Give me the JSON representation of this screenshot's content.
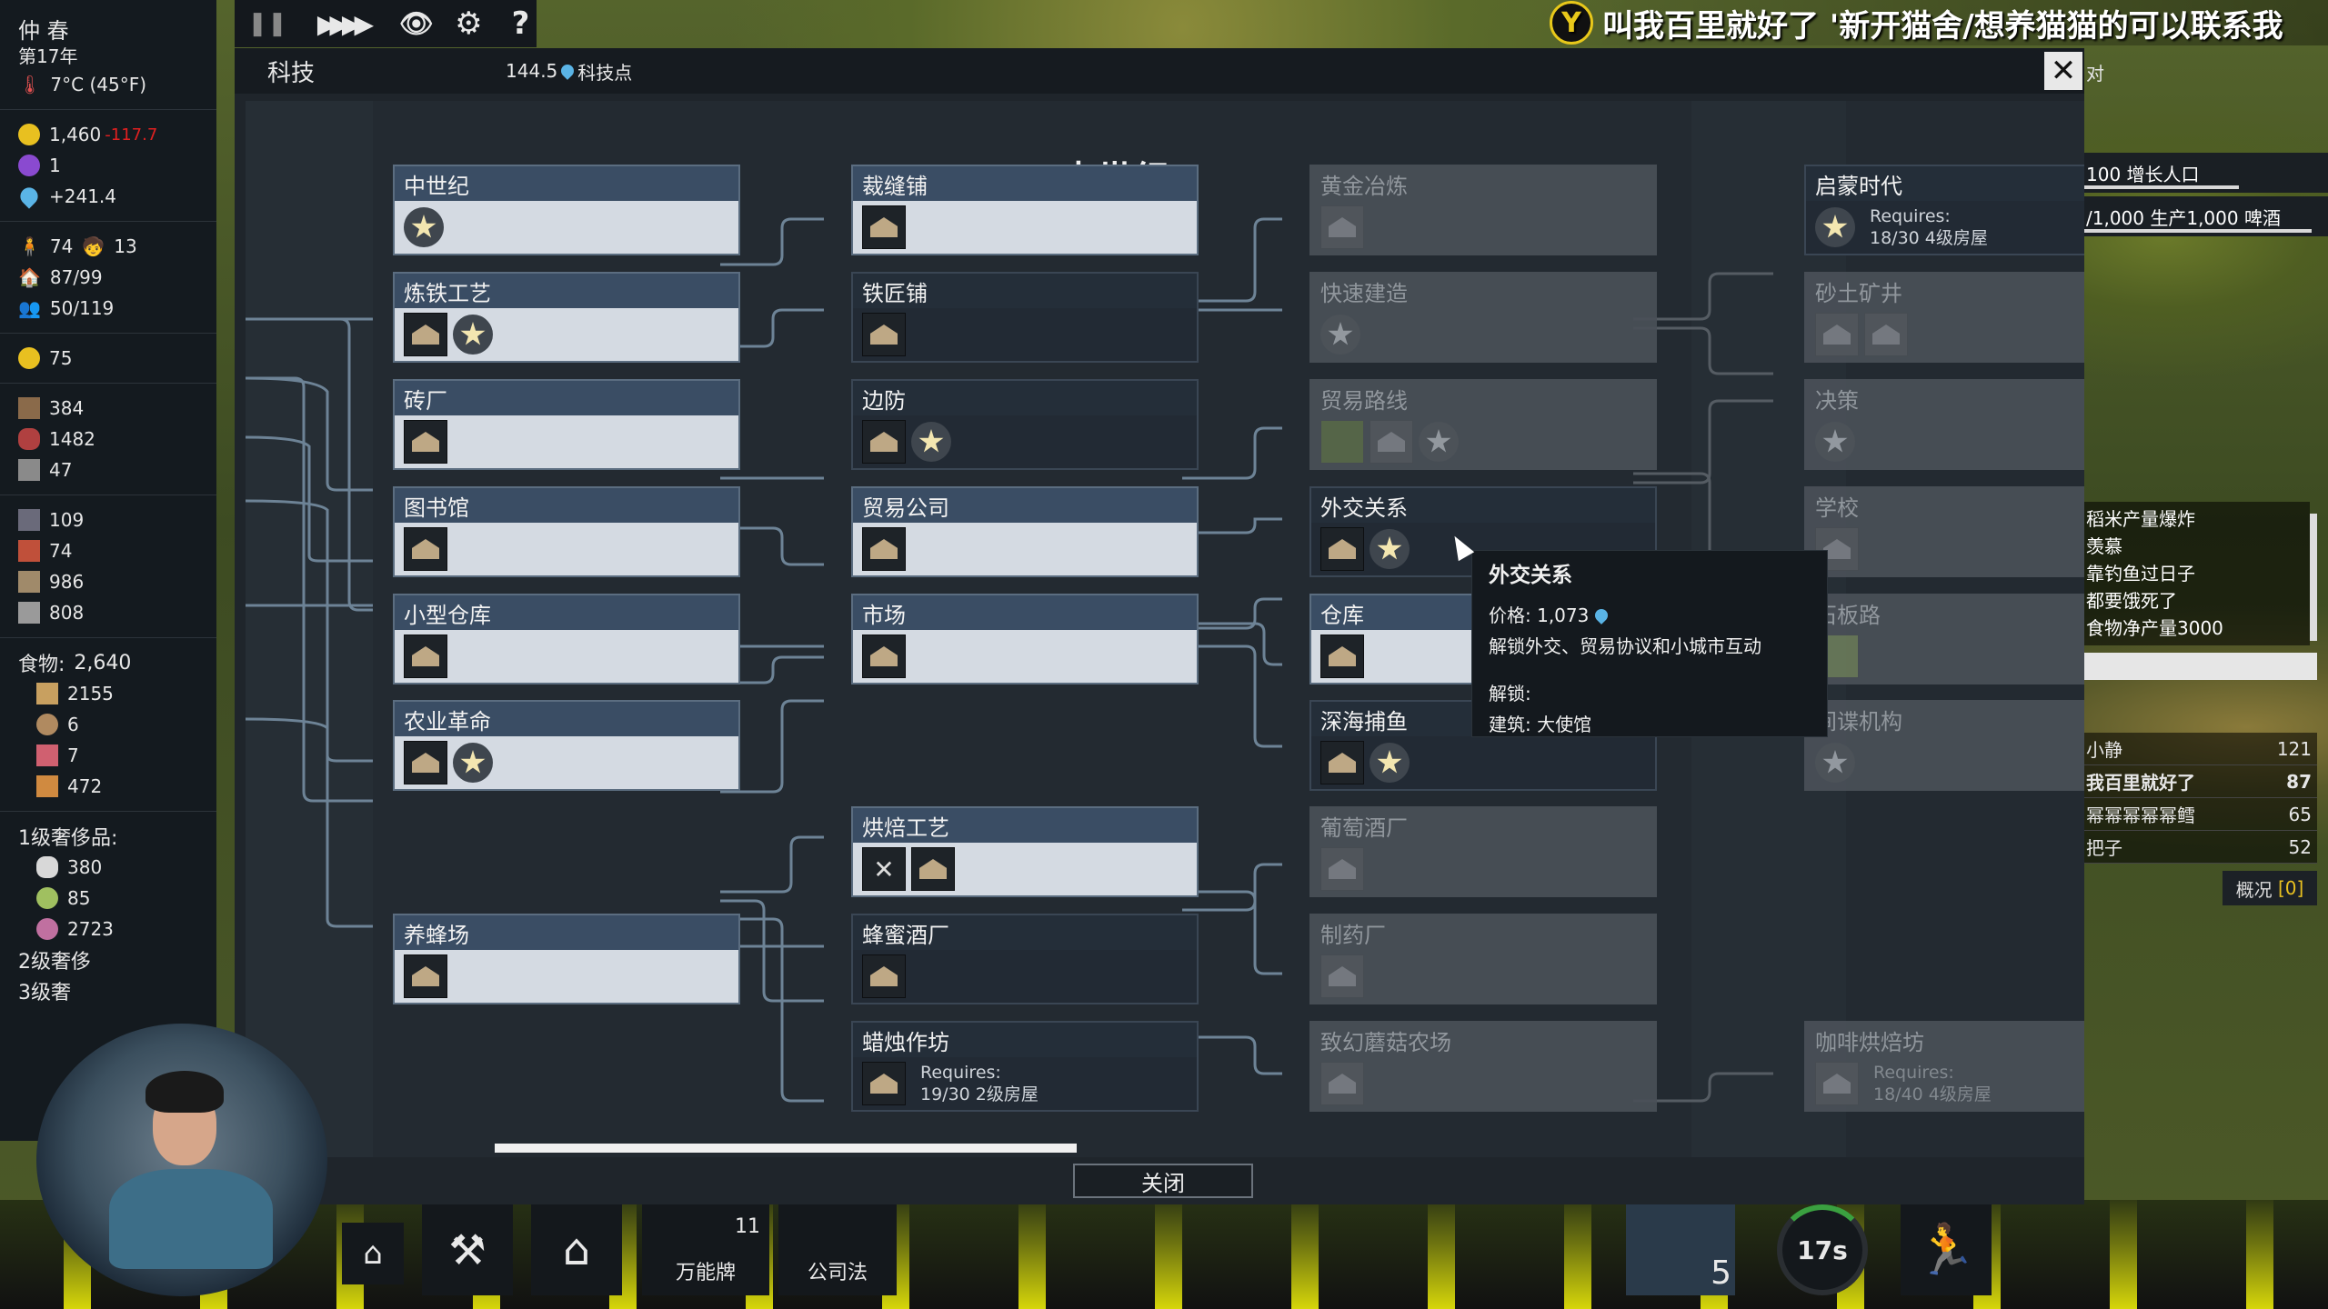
{
  "season": "仲 春",
  "year": "第17年",
  "temperature": "7°C (45°F)",
  "stats": {
    "gold": "1,460",
    "gold_delta": "-117.7",
    "purple": "1",
    "science": "+241.4",
    "pop_adult": "74",
    "pop_child": "13",
    "housing": "87/99",
    "workers": "50/119",
    "happiness": "75",
    "res": [
      "384",
      "1482",
      "47",
      "109",
      "74",
      "986",
      "808"
    ],
    "food_label": "食物:",
    "food_total": "2,640",
    "food": [
      "2155",
      "6",
      "7",
      "472"
    ],
    "lux1_label": "1级奢侈品:",
    "lux1": [
      "380",
      "85",
      "2723"
    ],
    "lux2_label": "2级奢侈",
    "lux3_label": "3级奢"
  },
  "topbar": {
    "pause": "❚❚",
    "fast": "▶▶▶▶",
    "eye": "👁",
    "gear": "⚙",
    "help": "?"
  },
  "banner": "叫我百里就好了 '新开猫舍/想养猫猫的可以联系我",
  "modal": {
    "title": "科技",
    "points_value": "144.5",
    "points_label": "科技点",
    "close_x": "✕",
    "era": "中世纪",
    "close_button": "关闭",
    "cut_label": "对"
  },
  "nodes": {
    "n1": "中世纪",
    "n2": "炼铁工艺",
    "n3": "砖厂",
    "n4": "图书馆",
    "n5": "小型仓库",
    "n6": "农业革命",
    "n7": "养蜂场",
    "m1": "裁缝铺",
    "m2": "铁匠铺",
    "m3": "边防",
    "m4": "贸易公司",
    "m5": "市场",
    "m6": "烘焙工艺",
    "m7": "蜂蜜酒厂",
    "m8": "蜡烛作坊",
    "m8_req1": "Requires:",
    "m8_req2": "19/30 2级房屋",
    "r1": "黄金冶炼",
    "r2": "快速建造",
    "r3": "贸易路线",
    "r4": "外交关系",
    "r5": "仓库",
    "r6": "深海捕鱼",
    "r7": "葡萄酒厂",
    "r8": "制药厂",
    "r9": "致幻蘑菇农场",
    "f1": "启蒙时代",
    "f1_req1": "Requires:",
    "f1_req2": "18/30 4级房屋",
    "f2": "砂土矿井",
    "f3": "决策",
    "f4": "学校",
    "f5": "石板路",
    "f6": "间谍机构",
    "f7": "咖啡烘焙坊",
    "f7_req1": "Requires:",
    "f7_req2": "18/40 4级房屋"
  },
  "tooltip": {
    "title": "外交关系",
    "price_label": "价格: 1,073",
    "desc": "解锁外交、贸易协议和小城市互动",
    "unlock_label": "解锁:",
    "unlock_value": "建筑: 大使馆"
  },
  "right": {
    "goal1": "100 增长人口",
    "goal2": "/1,000 生产1,000 啤酒",
    "events": [
      "稻米产量爆炸",
      "羡慕",
      "靠钓鱼过日子",
      "都要饿死了",
      "食物净产量3000"
    ],
    "input_value": "",
    "scores": [
      {
        "name": "小静",
        "value": "121"
      },
      {
        "name": "我百里就好了",
        "value": "87"
      },
      {
        "name": "幂幂幂幂幂鳕",
        "value": "65"
      },
      {
        "name": "把子",
        "value": "52"
      }
    ],
    "overview": "概况",
    "overview_count": "[0]"
  },
  "bottom": {
    "card_count": "11",
    "card_label": "万能牌",
    "company_label": "公司法",
    "queue_count": "5",
    "timer": "17s"
  },
  "colors": {
    "accent_blue": "#5ab4e6",
    "gold_delta": "#e02020",
    "unlocked_header": "#3a4d64",
    "locked": "#4a5058",
    "bar_yellow": "#d6d60a"
  }
}
